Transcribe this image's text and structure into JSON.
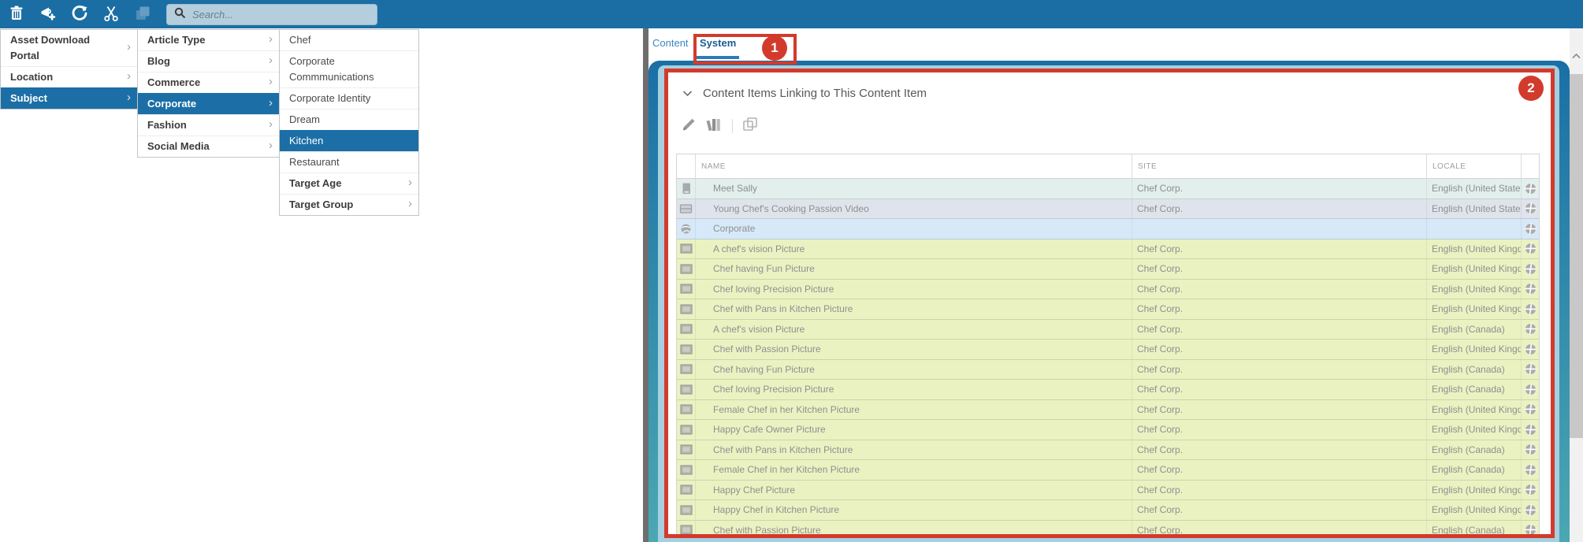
{
  "toolbar": {
    "search_placeholder": "Search...",
    "icons": [
      "delete-icon",
      "announcement-add-icon",
      "refresh-icon",
      "cut-icon",
      "copy-icon",
      "search-icon"
    ]
  },
  "menus": {
    "level1": [
      {
        "label": "Asset Download Portal",
        "bold": true,
        "submenu": true,
        "selected": false
      },
      {
        "label": "Location",
        "bold": true,
        "submenu": true,
        "selected": false
      },
      {
        "label": "Subject",
        "bold": true,
        "submenu": true,
        "selected": true
      }
    ],
    "level2": [
      {
        "label": "Article Type",
        "bold": true,
        "submenu": true,
        "selected": false
      },
      {
        "label": "Blog",
        "bold": true,
        "submenu": true,
        "selected": false
      },
      {
        "label": "Commerce",
        "bold": true,
        "submenu": true,
        "selected": false
      },
      {
        "label": "Corporate",
        "bold": true,
        "submenu": true,
        "selected": true
      },
      {
        "label": "Fashion",
        "bold": true,
        "submenu": true,
        "selected": false
      },
      {
        "label": "Social Media",
        "bold": true,
        "submenu": true,
        "selected": false
      }
    ],
    "level3": [
      {
        "label": "Chef",
        "bold": false,
        "submenu": false,
        "selected": false
      },
      {
        "label": "Corporate Commmunications",
        "bold": false,
        "submenu": false,
        "selected": false
      },
      {
        "label": "Corporate Identity",
        "bold": false,
        "submenu": false,
        "selected": false
      },
      {
        "label": "Dream",
        "bold": false,
        "submenu": false,
        "selected": false
      },
      {
        "label": "Kitchen",
        "bold": false,
        "submenu": false,
        "selected": true
      },
      {
        "label": "Restaurant",
        "bold": false,
        "submenu": false,
        "selected": false
      },
      {
        "label": "Target Age",
        "bold": true,
        "submenu": true,
        "selected": false
      },
      {
        "label": "Target Group",
        "bold": true,
        "submenu": true,
        "selected": false
      }
    ]
  },
  "tabs": [
    {
      "label": "Content",
      "active": false
    },
    {
      "label": "System",
      "active": true
    }
  ],
  "panel": {
    "title": "Content Items Linking to This Content Item",
    "collapse_icon": "chevron-down-icon",
    "toolbar_icons": [
      "edit-icon",
      "versions-icon",
      "copy-icon"
    ],
    "table": {
      "columns": [
        "NAME",
        "SITE",
        "LOCALE"
      ],
      "rows": [
        {
          "icon": "page-icon",
          "name": "Meet Sally",
          "site": "Chef Corp.",
          "locale": "English (United States)",
          "tint": "teal"
        },
        {
          "icon": "video-icon",
          "name": "Young Chef's Cooking Passion Video",
          "site": "Chef Corp.",
          "locale": "English (United States)",
          "tint": "bluegray"
        },
        {
          "icon": "globe-icon",
          "name": "Corporate",
          "site": "",
          "locale": "",
          "tint": "blue"
        },
        {
          "icon": "image-icon",
          "name": "A chef's vision Picture",
          "site": "Chef Corp.",
          "locale": "English (United Kingdom)",
          "tint": "green"
        },
        {
          "icon": "image-icon",
          "name": "Chef having Fun Picture",
          "site": "Chef Corp.",
          "locale": "English (United Kingdom)",
          "tint": "green"
        },
        {
          "icon": "image-icon",
          "name": "Chef loving Precision Picture",
          "site": "Chef Corp.",
          "locale": "English (United Kingdom)",
          "tint": "green"
        },
        {
          "icon": "image-icon",
          "name": "Chef with Pans in Kitchen Picture",
          "site": "Chef Corp.",
          "locale": "English (United Kingdom)",
          "tint": "green"
        },
        {
          "icon": "image-icon",
          "name": "A chef's vision Picture",
          "site": "Chef Corp.",
          "locale": "English (Canada)",
          "tint": "green"
        },
        {
          "icon": "image-icon",
          "name": "Chef with Passion Picture",
          "site": "Chef Corp.",
          "locale": "English (United Kingdom)",
          "tint": "green"
        },
        {
          "icon": "image-icon",
          "name": "Chef having Fun Picture",
          "site": "Chef Corp.",
          "locale": "English (Canada)",
          "tint": "green"
        },
        {
          "icon": "image-icon",
          "name": "Chef loving Precision Picture",
          "site": "Chef Corp.",
          "locale": "English (Canada)",
          "tint": "green"
        },
        {
          "icon": "image-icon",
          "name": "Female Chef in her Kitchen Picture",
          "site": "Chef Corp.",
          "locale": "English (United Kingdom)",
          "tint": "green"
        },
        {
          "icon": "image-icon",
          "name": "Happy Cafe Owner Picture",
          "site": "Chef Corp.",
          "locale": "English (United Kingdom)",
          "tint": "green"
        },
        {
          "icon": "image-icon",
          "name": "Chef with Pans in Kitchen Picture",
          "site": "Chef Corp.",
          "locale": "English (Canada)",
          "tint": "green"
        },
        {
          "icon": "image-icon",
          "name": "Female Chef in her Kitchen Picture",
          "site": "Chef Corp.",
          "locale": "English (Canada)",
          "tint": "green"
        },
        {
          "icon": "image-icon",
          "name": "Happy Chef Picture",
          "site": "Chef Corp.",
          "locale": "English (United Kingdom)",
          "tint": "green"
        },
        {
          "icon": "image-icon",
          "name": "Happy Chef in Kitchen Picture",
          "site": "Chef Corp.",
          "locale": "English (United Kingdom)",
          "tint": "green"
        },
        {
          "icon": "image-icon",
          "name": "Chef with Passion Picture",
          "site": "Chef Corp.",
          "locale": "English (Canada)",
          "tint": "green"
        }
      ],
      "row_trailing_icon": "language-globe-icon"
    }
  },
  "annotations": [
    {
      "number": "1"
    },
    {
      "number": "2"
    }
  ],
  "colors": {
    "topbar_blue": "#1a6ea4",
    "selection_blue": "#1b6fa6",
    "annotation_red": "#d23b2c",
    "panel_top": "#1a6fa5",
    "panel_bottom": "#4ba7b2",
    "panel_inner": "#a6cfe0",
    "tint_teal": "#e2efec",
    "tint_bluegray": "#dfe4ec",
    "tint_blue": "#d7e9f8",
    "tint_green": "#eaf2c2",
    "tab_active": "#195d94",
    "tab_inactive": "#3a87c4",
    "row_text": "#8f8f8f"
  }
}
